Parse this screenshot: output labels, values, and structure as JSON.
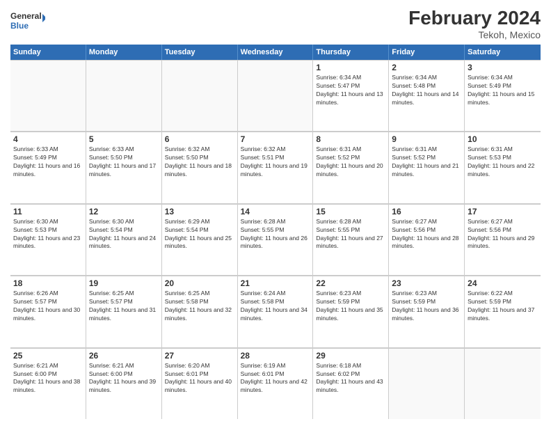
{
  "header": {
    "logo_general": "General",
    "logo_blue": "Blue",
    "title": "February 2024",
    "subtitle": "Tekoh, Mexico"
  },
  "days_of_week": [
    "Sunday",
    "Monday",
    "Tuesday",
    "Wednesday",
    "Thursday",
    "Friday",
    "Saturday"
  ],
  "weeks": [
    {
      "cells": [
        {
          "day": "",
          "empty": true
        },
        {
          "day": "",
          "empty": true
        },
        {
          "day": "",
          "empty": true
        },
        {
          "day": "",
          "empty": true
        },
        {
          "day": "1",
          "sunrise": "Sunrise: 6:34 AM",
          "sunset": "Sunset: 5:47 PM",
          "daylight": "Daylight: 11 hours and 13 minutes."
        },
        {
          "day": "2",
          "sunrise": "Sunrise: 6:34 AM",
          "sunset": "Sunset: 5:48 PM",
          "daylight": "Daylight: 11 hours and 14 minutes."
        },
        {
          "day": "3",
          "sunrise": "Sunrise: 6:34 AM",
          "sunset": "Sunset: 5:49 PM",
          "daylight": "Daylight: 11 hours and 15 minutes."
        }
      ]
    },
    {
      "cells": [
        {
          "day": "4",
          "sunrise": "Sunrise: 6:33 AM",
          "sunset": "Sunset: 5:49 PM",
          "daylight": "Daylight: 11 hours and 16 minutes."
        },
        {
          "day": "5",
          "sunrise": "Sunrise: 6:33 AM",
          "sunset": "Sunset: 5:50 PM",
          "daylight": "Daylight: 11 hours and 17 minutes."
        },
        {
          "day": "6",
          "sunrise": "Sunrise: 6:32 AM",
          "sunset": "Sunset: 5:50 PM",
          "daylight": "Daylight: 11 hours and 18 minutes."
        },
        {
          "day": "7",
          "sunrise": "Sunrise: 6:32 AM",
          "sunset": "Sunset: 5:51 PM",
          "daylight": "Daylight: 11 hours and 19 minutes."
        },
        {
          "day": "8",
          "sunrise": "Sunrise: 6:31 AM",
          "sunset": "Sunset: 5:52 PM",
          "daylight": "Daylight: 11 hours and 20 minutes."
        },
        {
          "day": "9",
          "sunrise": "Sunrise: 6:31 AM",
          "sunset": "Sunset: 5:52 PM",
          "daylight": "Daylight: 11 hours and 21 minutes."
        },
        {
          "day": "10",
          "sunrise": "Sunrise: 6:31 AM",
          "sunset": "Sunset: 5:53 PM",
          "daylight": "Daylight: 11 hours and 22 minutes."
        }
      ]
    },
    {
      "cells": [
        {
          "day": "11",
          "sunrise": "Sunrise: 6:30 AM",
          "sunset": "Sunset: 5:53 PM",
          "daylight": "Daylight: 11 hours and 23 minutes."
        },
        {
          "day": "12",
          "sunrise": "Sunrise: 6:30 AM",
          "sunset": "Sunset: 5:54 PM",
          "daylight": "Daylight: 11 hours and 24 minutes."
        },
        {
          "day": "13",
          "sunrise": "Sunrise: 6:29 AM",
          "sunset": "Sunset: 5:54 PM",
          "daylight": "Daylight: 11 hours and 25 minutes."
        },
        {
          "day": "14",
          "sunrise": "Sunrise: 6:28 AM",
          "sunset": "Sunset: 5:55 PM",
          "daylight": "Daylight: 11 hours and 26 minutes."
        },
        {
          "day": "15",
          "sunrise": "Sunrise: 6:28 AM",
          "sunset": "Sunset: 5:55 PM",
          "daylight": "Daylight: 11 hours and 27 minutes."
        },
        {
          "day": "16",
          "sunrise": "Sunrise: 6:27 AM",
          "sunset": "Sunset: 5:56 PM",
          "daylight": "Daylight: 11 hours and 28 minutes."
        },
        {
          "day": "17",
          "sunrise": "Sunrise: 6:27 AM",
          "sunset": "Sunset: 5:56 PM",
          "daylight": "Daylight: 11 hours and 29 minutes."
        }
      ]
    },
    {
      "cells": [
        {
          "day": "18",
          "sunrise": "Sunrise: 6:26 AM",
          "sunset": "Sunset: 5:57 PM",
          "daylight": "Daylight: 11 hours and 30 minutes."
        },
        {
          "day": "19",
          "sunrise": "Sunrise: 6:25 AM",
          "sunset": "Sunset: 5:57 PM",
          "daylight": "Daylight: 11 hours and 31 minutes."
        },
        {
          "day": "20",
          "sunrise": "Sunrise: 6:25 AM",
          "sunset": "Sunset: 5:58 PM",
          "daylight": "Daylight: 11 hours and 32 minutes."
        },
        {
          "day": "21",
          "sunrise": "Sunrise: 6:24 AM",
          "sunset": "Sunset: 5:58 PM",
          "daylight": "Daylight: 11 hours and 34 minutes."
        },
        {
          "day": "22",
          "sunrise": "Sunrise: 6:23 AM",
          "sunset": "Sunset: 5:59 PM",
          "daylight": "Daylight: 11 hours and 35 minutes."
        },
        {
          "day": "23",
          "sunrise": "Sunrise: 6:23 AM",
          "sunset": "Sunset: 5:59 PM",
          "daylight": "Daylight: 11 hours and 36 minutes."
        },
        {
          "day": "24",
          "sunrise": "Sunrise: 6:22 AM",
          "sunset": "Sunset: 5:59 PM",
          "daylight": "Daylight: 11 hours and 37 minutes."
        }
      ]
    },
    {
      "cells": [
        {
          "day": "25",
          "sunrise": "Sunrise: 6:21 AM",
          "sunset": "Sunset: 6:00 PM",
          "daylight": "Daylight: 11 hours and 38 minutes."
        },
        {
          "day": "26",
          "sunrise": "Sunrise: 6:21 AM",
          "sunset": "Sunset: 6:00 PM",
          "daylight": "Daylight: 11 hours and 39 minutes."
        },
        {
          "day": "27",
          "sunrise": "Sunrise: 6:20 AM",
          "sunset": "Sunset: 6:01 PM",
          "daylight": "Daylight: 11 hours and 40 minutes."
        },
        {
          "day": "28",
          "sunrise": "Sunrise: 6:19 AM",
          "sunset": "Sunset: 6:01 PM",
          "daylight": "Daylight: 11 hours and 42 minutes."
        },
        {
          "day": "29",
          "sunrise": "Sunrise: 6:18 AM",
          "sunset": "Sunset: 6:02 PM",
          "daylight": "Daylight: 11 hours and 43 minutes."
        },
        {
          "day": "",
          "empty": true
        },
        {
          "day": "",
          "empty": true
        }
      ]
    }
  ]
}
